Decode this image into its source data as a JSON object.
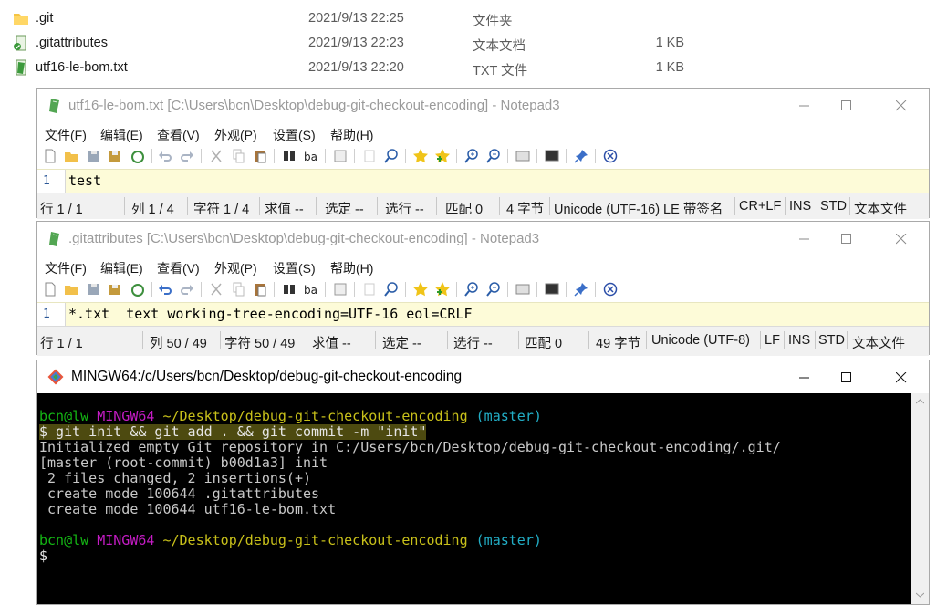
{
  "explorer": {
    "files": [
      {
        "name": ".git",
        "date": "2021/9/13 22:25",
        "type": "文件夹",
        "size": "",
        "icon": "folder-icon"
      },
      {
        "name": ".gitattributes",
        "date": "2021/9/13 22:23",
        "type": "文本文档",
        "size": "1 KB",
        "icon": "notepad3-file-icon"
      },
      {
        "name": "utf16-le-bom.txt",
        "date": "2021/9/13 22:20",
        "type": "TXT 文件",
        "size": "1 KB",
        "icon": "notepad3-file-icon"
      }
    ]
  },
  "notepad1": {
    "title": "utf16-le-bom.txt [C:\\Users\\bcn\\Desktop\\debug-git-checkout-encoding] - Notepad3",
    "menu": [
      "文件(F)",
      "编辑(E)",
      "查看(V)",
      "外观(P)",
      "设置(S)",
      "帮助(H)"
    ],
    "line_number": "1",
    "content": "test",
    "status": [
      "行 1 / 1",
      "列 1 / 4",
      "字符 1 / 4",
      "求值 --",
      "选定 --",
      "选行 --",
      "匹配 0",
      "4 字节",
      "Unicode (UTF-16) LE 带签名",
      "CR+LF",
      "INS",
      "STD",
      "文本文件"
    ]
  },
  "notepad2": {
    "title": ".gitattributes [C:\\Users\\bcn\\Desktop\\debug-git-checkout-encoding] - Notepad3",
    "menu": [
      "文件(F)",
      "编辑(E)",
      "查看(V)",
      "外观(P)",
      "设置(S)",
      "帮助(H)"
    ],
    "line_number": "1",
    "content": "*.txt  text working-tree-encoding=UTF-16 eol=CRLF",
    "status": [
      "行 1 / 1",
      "列 50 / 49",
      "字符 50 / 49",
      "求值 --",
      "选定 --",
      "选行 --",
      "匹配 0",
      "49 字节",
      "Unicode (UTF-8)",
      "LF",
      "INS",
      "STD",
      "文本文件"
    ]
  },
  "terminal": {
    "title": "MINGW64:/c/Users/bcn/Desktop/debug-git-checkout-encoding",
    "prompt": {
      "user": "bcn@lw",
      "env": "MINGW64",
      "path": "~/Desktop/debug-git-checkout-encoding",
      "branch": "(master)"
    },
    "command": "$ git init && git add . && git commit -m \"init\"",
    "output": [
      "Initialized empty Git repository in C:/Users/bcn/Desktop/debug-git-checkout-encoding/.git/",
      "[master (root-commit) b00d1a3] init",
      " 2 files changed, 2 insertions(+)",
      " create mode 100644 .gitattributes",
      " create mode 100644 utf16-le-bom.txt"
    ],
    "cursor_prompt": "$"
  },
  "colors": {
    "prompt_user": "#14b514",
    "prompt_env": "#c51cc5",
    "prompt_path": "#c8c01a",
    "prompt_branch": "#22aec6",
    "editor_bg": "#fdfbd8"
  }
}
